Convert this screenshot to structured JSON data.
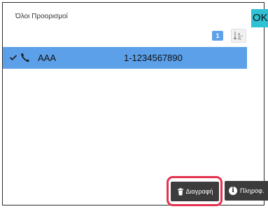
{
  "header": {
    "title": "Όλοι Προορισμοί",
    "ok_label": "OK"
  },
  "pagination": {
    "page": "1"
  },
  "sort": {
    "icon": "sort-az-icon"
  },
  "list": {
    "items": [
      {
        "selected": true,
        "type_icon": "phone-icon",
        "name": "AAA",
        "number": "1-1234567890"
      }
    ]
  },
  "footer": {
    "delete_label": "Διαγραφή",
    "info_label": "Πληροφ."
  },
  "colors": {
    "accent": "#2fc1d4",
    "selection": "#5ba0e9",
    "highlight": "#e4334f",
    "button_bg": "#3c3c3c"
  }
}
